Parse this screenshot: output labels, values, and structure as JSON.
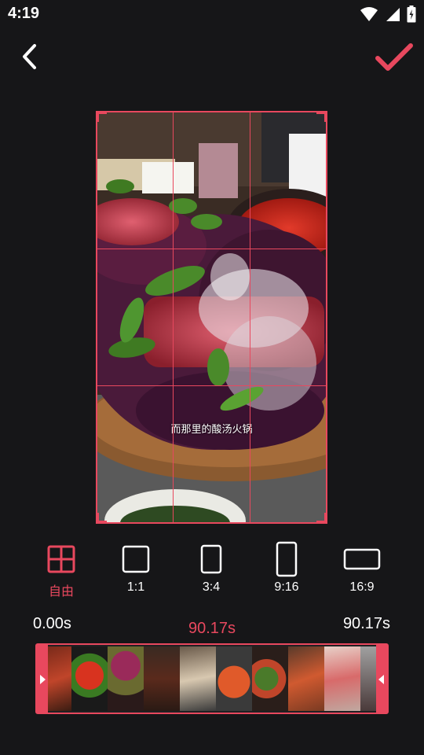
{
  "status_bar": {
    "time": "4:19"
  },
  "toolbar": {
    "back_icon": "chevron-left-icon",
    "confirm_icon": "checkmark-icon",
    "accent_color": "#e8485e"
  },
  "preview": {
    "subtitle": "而那里的酸汤火锅"
  },
  "ratios": [
    {
      "label": "自由",
      "icon": "free-grid-icon",
      "selected": true
    },
    {
      "label": "1:1",
      "icon": "square-icon",
      "selected": false
    },
    {
      "label": "3:4",
      "icon": "portrait-3-4-icon",
      "selected": false
    },
    {
      "label": "9:16",
      "icon": "portrait-9-16-icon",
      "selected": false
    },
    {
      "label": "16:9",
      "icon": "landscape-16-9-icon",
      "selected": false
    }
  ],
  "timeline": {
    "start_time": "0.00s",
    "current_time": "90.17s",
    "end_time": "90.17s"
  }
}
